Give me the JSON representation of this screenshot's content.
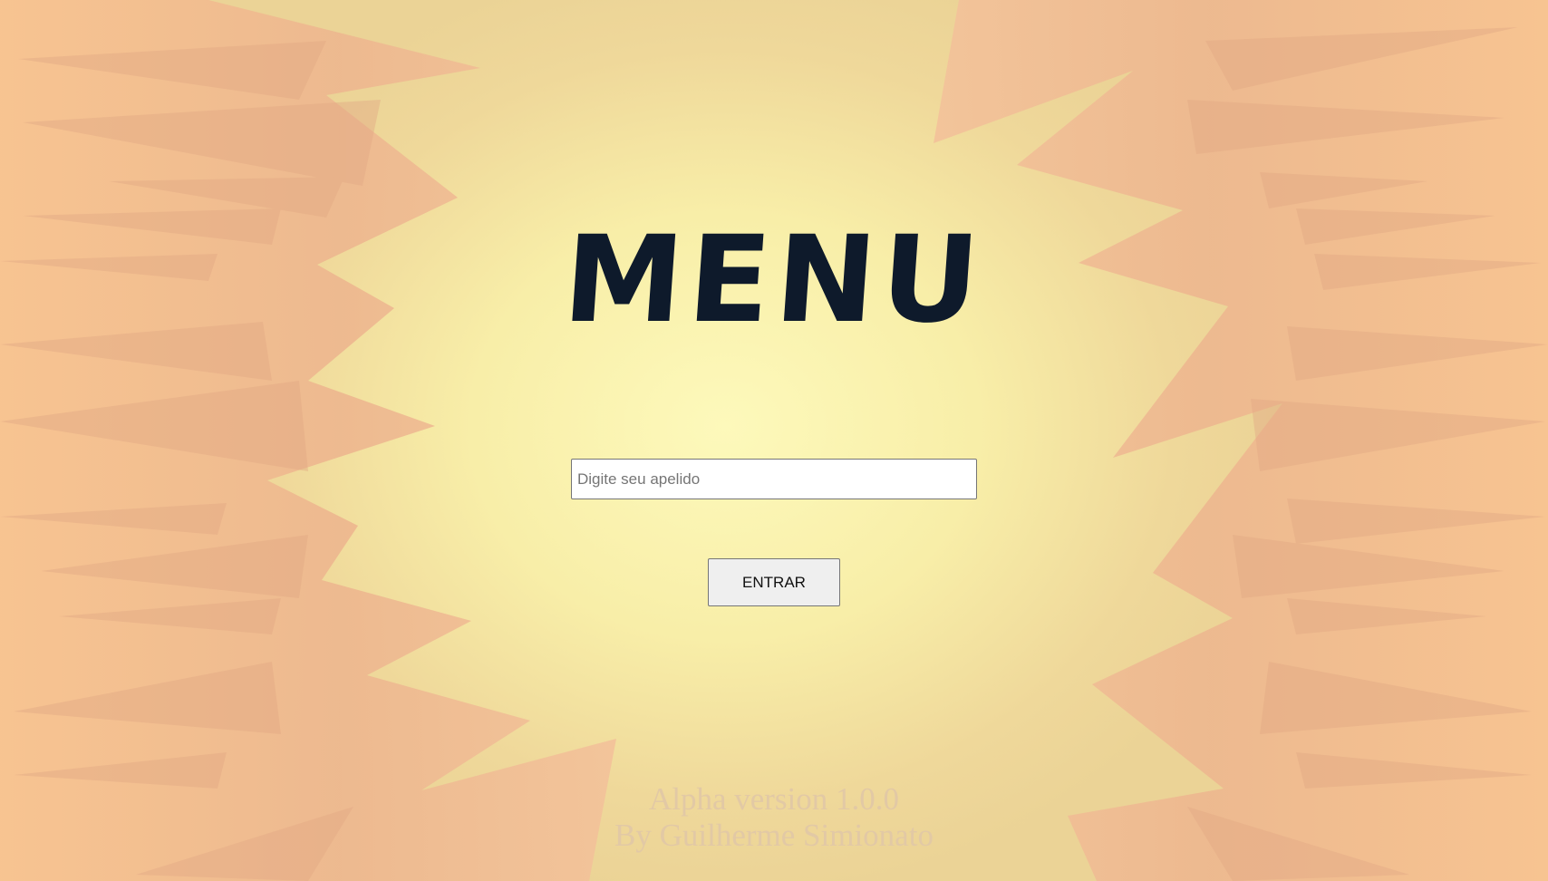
{
  "menu": {
    "title": "MENU",
    "nickname_placeholder": "Digite seu apelido",
    "nickname_value": "",
    "enter_label": "ENTRAR"
  },
  "footer": {
    "version": "Alpha version 1.0.0",
    "author": "By Guilherme Simionato"
  },
  "colors": {
    "background_center": "#fdf9bb",
    "background_edge": "#ebd396",
    "burst": "#f4b98b",
    "title": "#0e1a2b",
    "footer_text": "#e2c9a5"
  }
}
